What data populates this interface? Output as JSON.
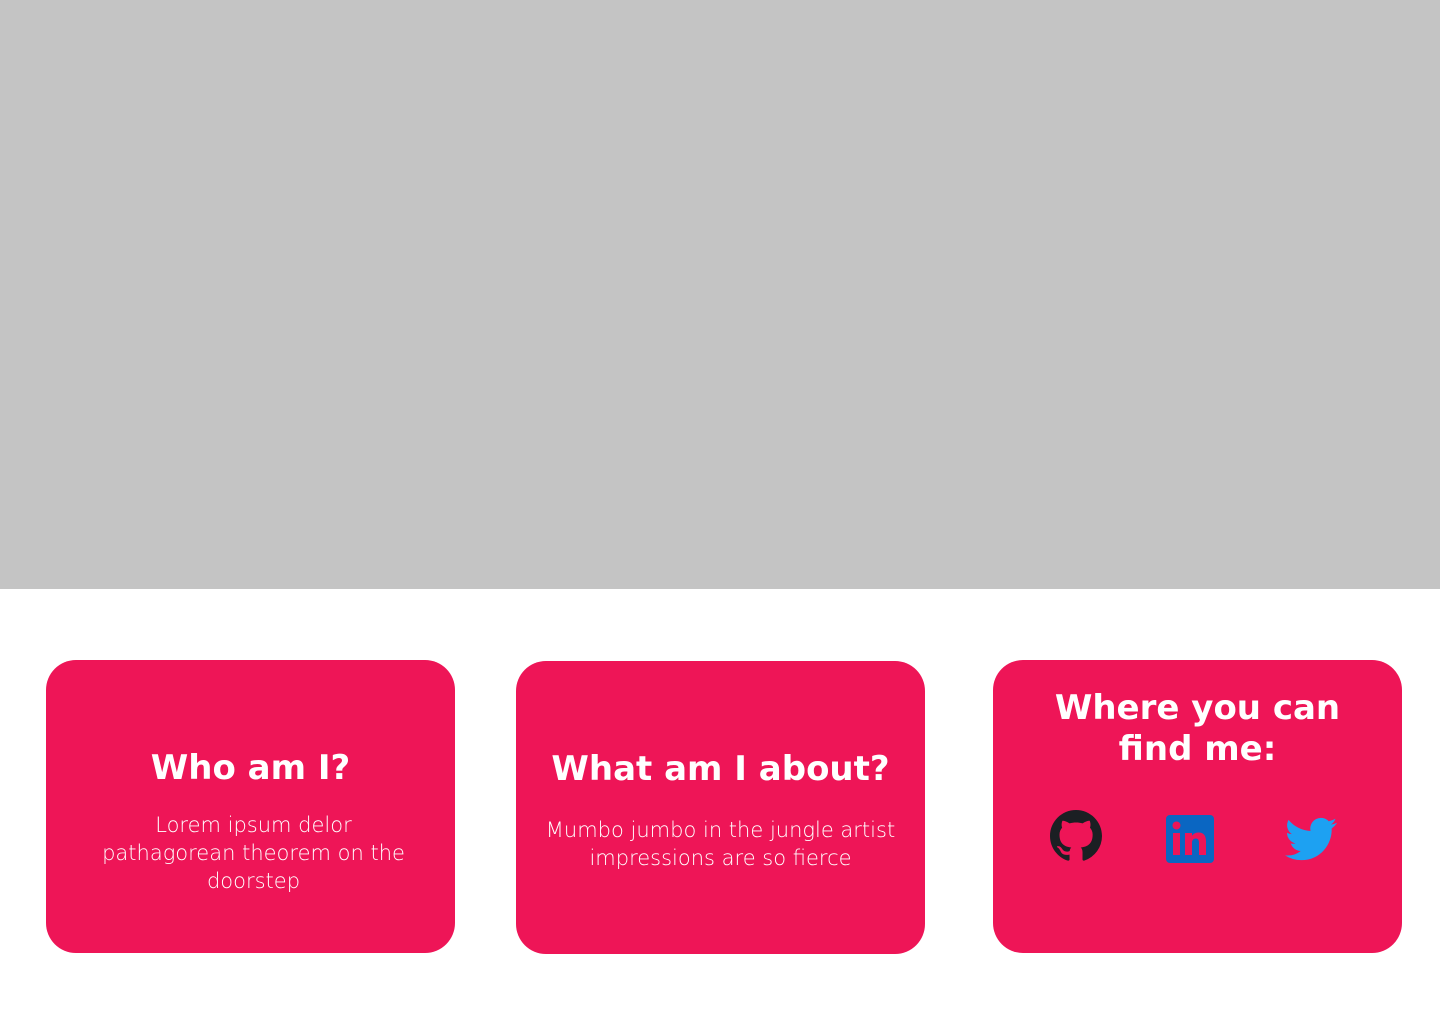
{
  "hero": {
    "color": "#c4c4c4"
  },
  "cards": [
    {
      "title": "Who am I?",
      "text": "Lorem ipsum delor pathagorean theorem on the doorstep"
    },
    {
      "title": "What am I about?",
      "text": "Mumbo jumbo in the jungle artist impressions are so fierce"
    },
    {
      "title": "Where you can find me:",
      "links": [
        {
          "icon": "github-icon"
        },
        {
          "icon": "linkedin-icon"
        },
        {
          "icon": "twitter-icon"
        }
      ]
    }
  ],
  "colors": {
    "card_background": "#ee1557",
    "card_text": "#ffffff",
    "linkedin_blue": "#0a66c2",
    "twitter_blue": "#1da1f2",
    "github_black": "#1b1f23"
  }
}
